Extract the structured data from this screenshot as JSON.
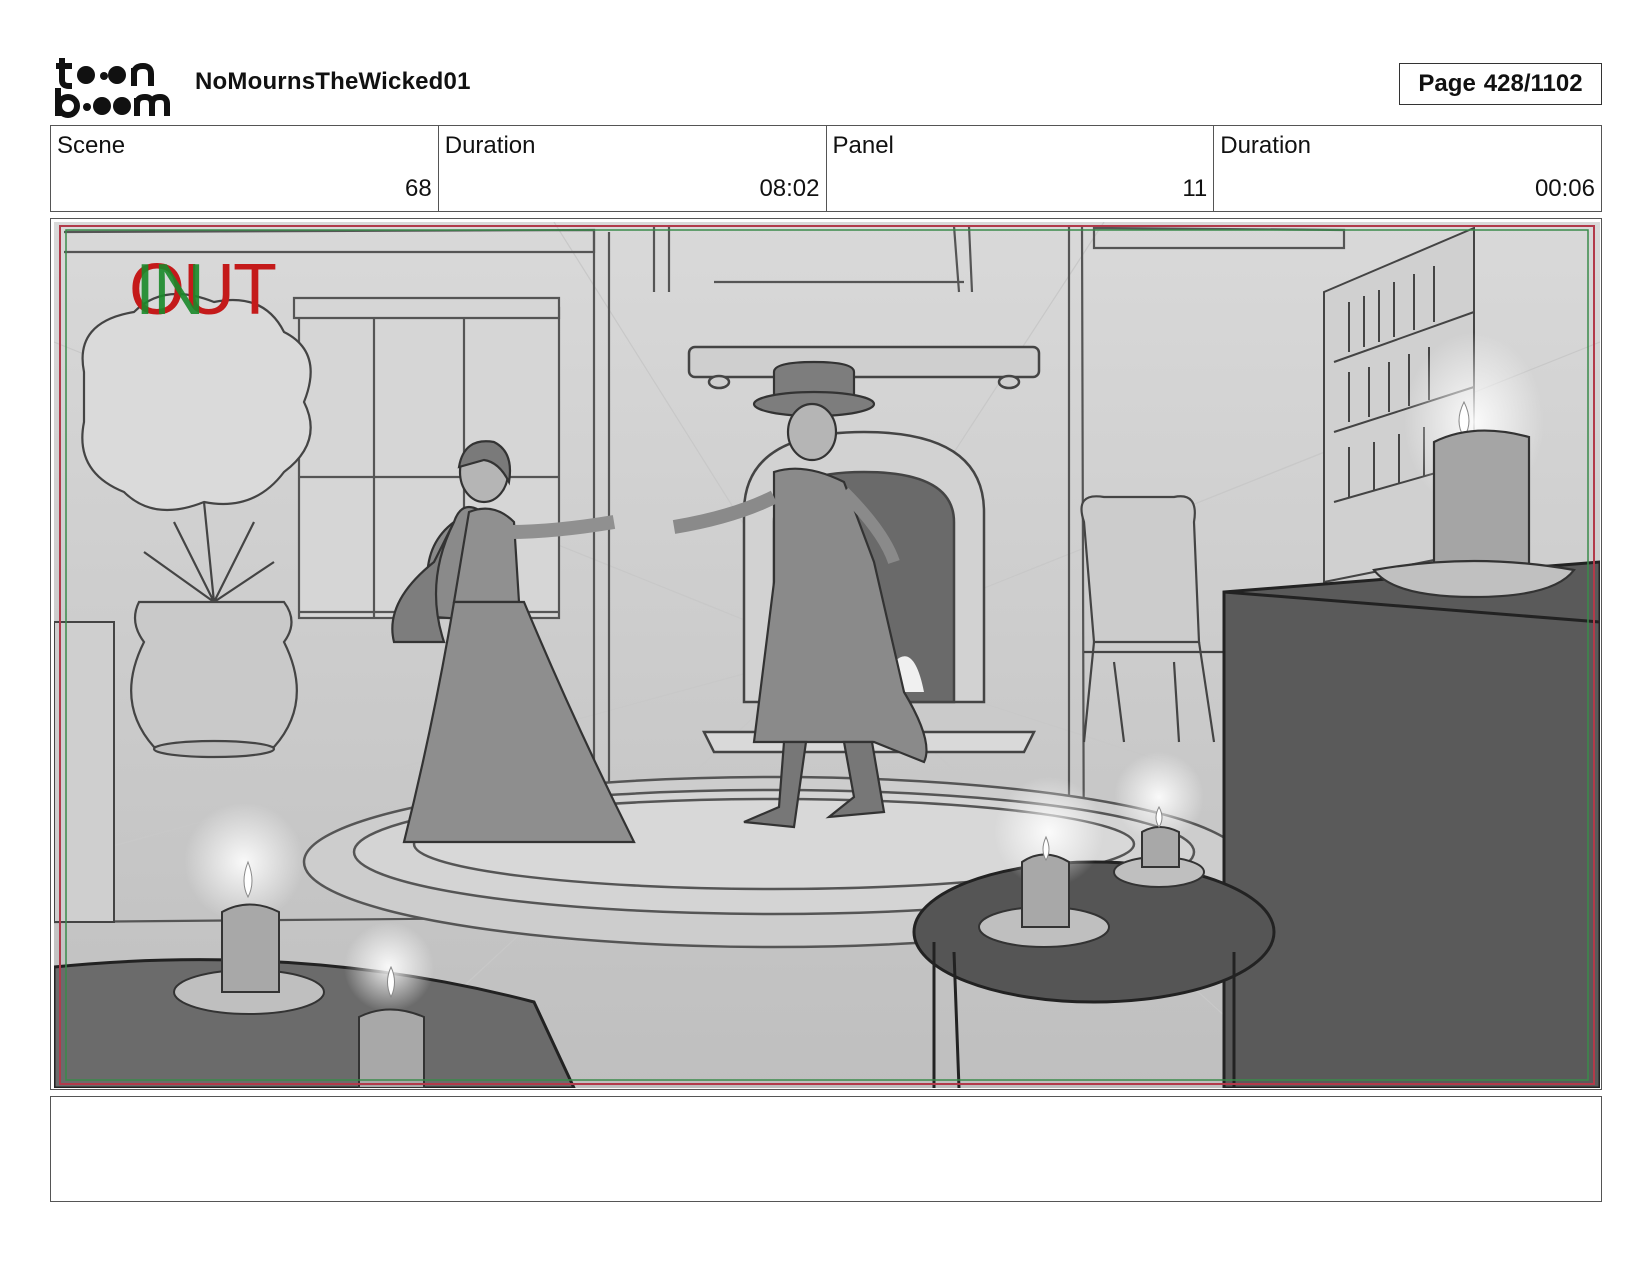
{
  "header": {
    "logo_text_top": "toon",
    "logo_text_bottom": "boom",
    "project_title": "NoMournsTheWicked01",
    "page_label": "Page",
    "page_number": "428/1102"
  },
  "info": [
    {
      "label": "Scene",
      "value": "68"
    },
    {
      "label": "Duration",
      "value": "08:02"
    },
    {
      "label": "Panel",
      "value": "11"
    },
    {
      "label": "Duration",
      "value": "00:06"
    }
  ],
  "panel": {
    "in_marker": "IN",
    "out_marker": "OUT"
  },
  "notes": {
    "text": ""
  },
  "colors": {
    "out_marker": "#c41a1a",
    "in_marker": "#1a8a2a",
    "safe_frame_red": "#b23a4a",
    "safe_frame_green": "#3a8a4a"
  }
}
